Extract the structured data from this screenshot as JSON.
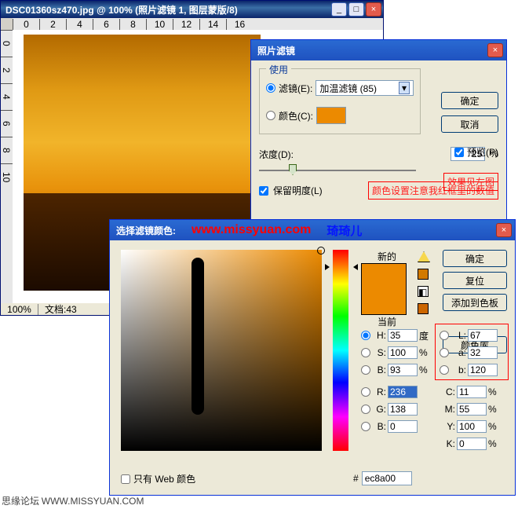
{
  "doc": {
    "title": "DSC01360sz470.jpg @ 100% (照片滤镜 1, 图层蒙版/8)",
    "ruler_h": [
      "0",
      "2",
      "4",
      "6",
      "8",
      "10",
      "12",
      "14",
      "16"
    ],
    "ruler_v": [
      "0",
      "2",
      "4",
      "6",
      "8",
      "10"
    ],
    "zoom": "100%",
    "docinfo": "文档:43"
  },
  "filter": {
    "title": "照片滤镜",
    "use_group": "使用",
    "filter_radio": "滤镜(E):",
    "filter_select": "加温滤镜 (85)",
    "color_radio": "颜色(C):",
    "color_swatch": "#ec8a00",
    "density_label": "浓度(D):",
    "density_value": "25",
    "density_unit": "%",
    "preserve_label": "保留明度(L)",
    "note": "颜色设置注意我红框里的数值",
    "ok": "确定",
    "cancel": "取消",
    "preview": "预览(P)",
    "effect_note": "效果见左图"
  },
  "picker": {
    "title": "选择滤镜颜色:",
    "site": "www.missyuan.com",
    "nick": "琦琦儿",
    "new_label": "新的",
    "current_label": "当前",
    "ok": "确定",
    "reset": "复位",
    "add": "添加到色板",
    "lib": "颜色库",
    "H": {
      "label": "H:",
      "val": "35",
      "unit": "度"
    },
    "S": {
      "label": "S:",
      "val": "100",
      "unit": "%"
    },
    "B": {
      "label": "B:",
      "val": "93",
      "unit": "%"
    },
    "R": {
      "label": "R:",
      "val": "236"
    },
    "G": {
      "label": "G:",
      "val": "138"
    },
    "Bv": {
      "label": "B:",
      "val": "0"
    },
    "L": {
      "label": "L:",
      "val": "67"
    },
    "a": {
      "label": "a:",
      "val": "32"
    },
    "b": {
      "label": "b:",
      "val": "120"
    },
    "C": {
      "label": "C:",
      "val": "11",
      "unit": "%"
    },
    "M": {
      "label": "M:",
      "val": "55",
      "unit": "%"
    },
    "Y": {
      "label": "Y:",
      "val": "100",
      "unit": "%"
    },
    "K": {
      "label": "K:",
      "val": "0",
      "unit": "%"
    },
    "hex_label": "#",
    "hex": "ec8a00",
    "web_only": "只有 Web 颜色",
    "swatch_new": "#ec8a00",
    "swatch_cur": "#ec8a00",
    "warn_swatch": "#d27a00"
  },
  "credit": {
    "label": "思缘论坛",
    "url": "WWW.MISSYUAN.COM"
  }
}
